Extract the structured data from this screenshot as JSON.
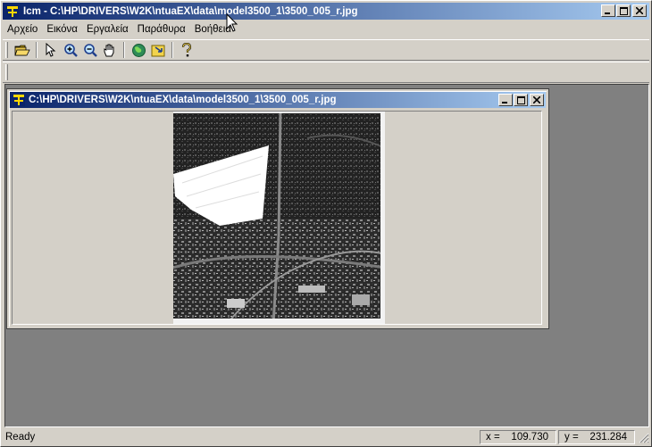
{
  "window": {
    "title": "Icm - C:\\HP\\DRIVERS\\W2K\\ntuaEX\\data\\model3500_1\\3500_005_r.jpg"
  },
  "menu": {
    "items": [
      "Αρχείο",
      "Εικόνα",
      "Εργαλεία",
      "Παράθυρα",
      "Βοήθεια"
    ]
  },
  "toolbar": {
    "icons": [
      "open-folder-icon",
      "pointer-arrow-icon",
      "zoom-in-icon",
      "zoom-out-icon",
      "pan-hand-icon",
      "globe-icon",
      "export-icon",
      "help-icon"
    ]
  },
  "child_window": {
    "title": "C:\\HP\\DRIVERS\\W2K\\ntuaEX\\data\\model3500_1\\3500_005_r.jpg"
  },
  "status": {
    "ready": "Ready",
    "x_label": "x =",
    "x_value": "109.730",
    "y_label": "y =",
    "y_value": "231.284"
  },
  "colors": {
    "titlebar_start": "#0a246a",
    "titlebar_end": "#a6caf0",
    "face": "#d4d0c8",
    "mdi_background": "#808080"
  }
}
